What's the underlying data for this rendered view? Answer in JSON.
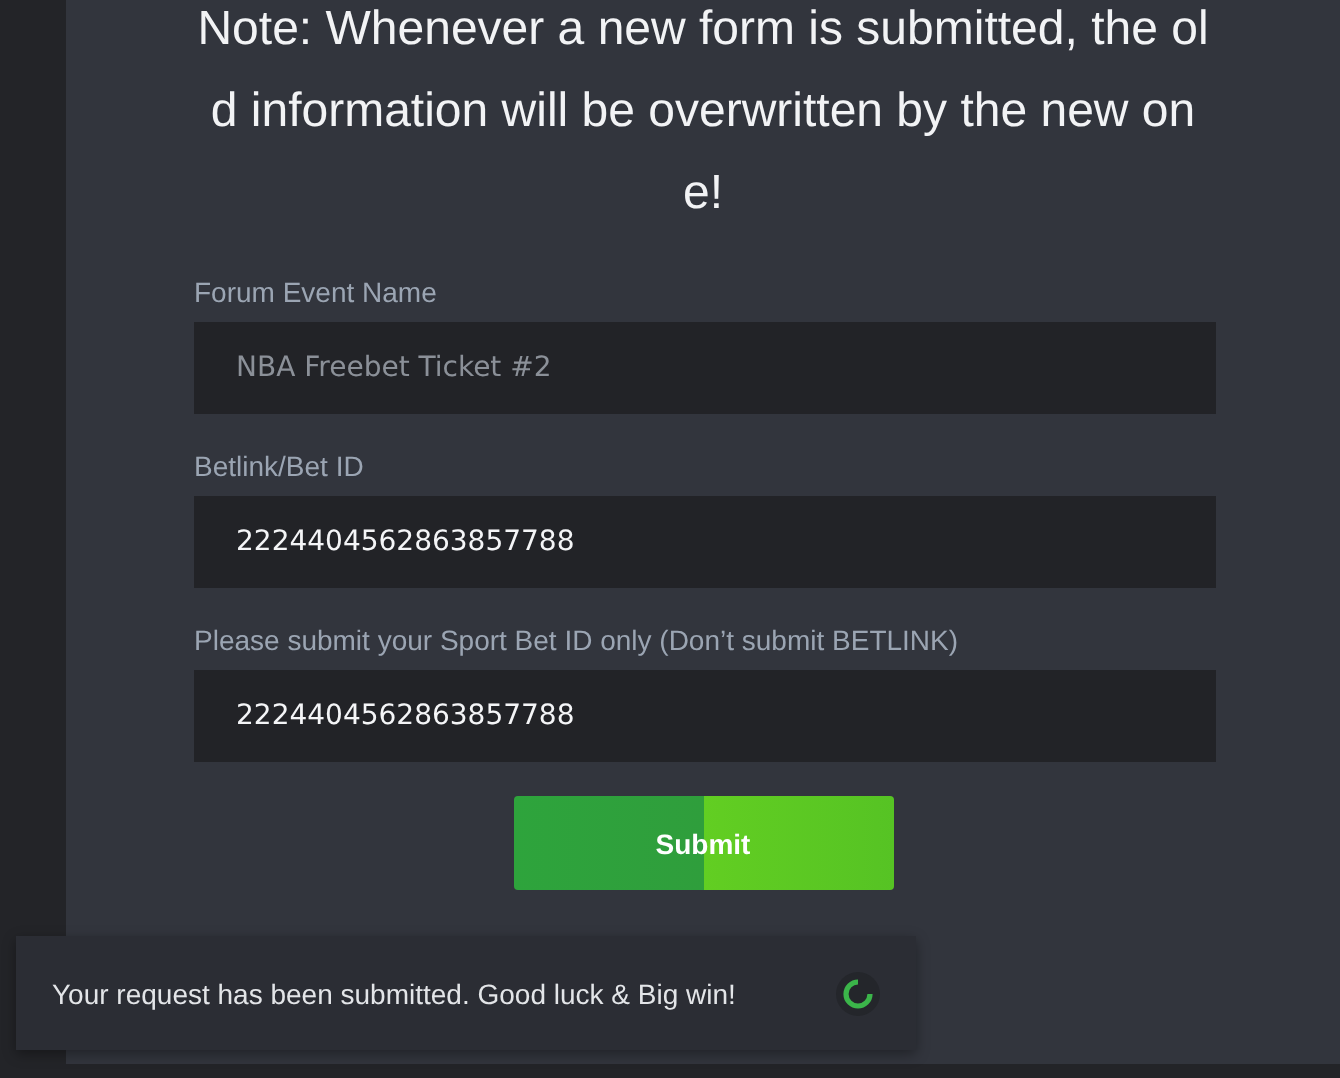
{
  "note": {
    "lines": [
      "Note: Whenever a new form is submitted, the ol",
      "d information will be overwritten by the new on",
      "e!"
    ]
  },
  "fields": [
    {
      "label": "Forum Event Name",
      "placeholder": "NBA Freebet Ticket #2"
    },
    {
      "label": "Betlink/Bet ID",
      "value": "2224404562863857788"
    },
    {
      "label": "Please submit your Sport Bet ID only (Don’t submit BETLINK)",
      "value": "2224404562863857788"
    }
  ],
  "submit": {
    "label": "Submit"
  },
  "toast": {
    "message": "Your request has been submitted. Good luck & Big win!"
  }
}
